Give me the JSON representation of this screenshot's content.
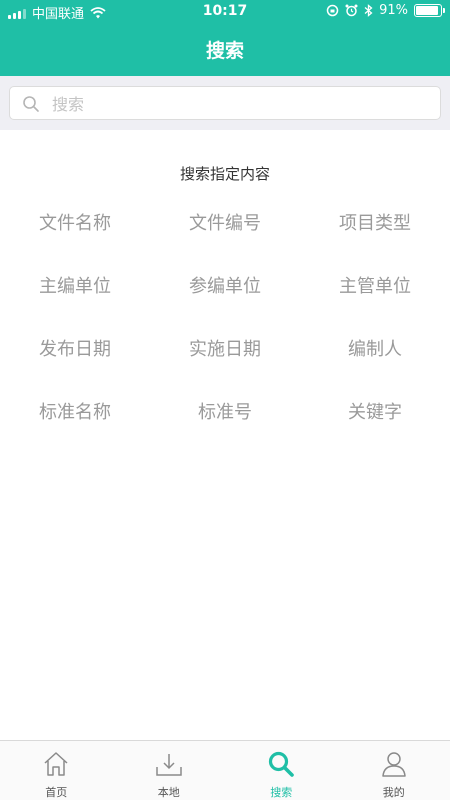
{
  "status": {
    "carrier": "中国联通",
    "time": "10:17",
    "battery": "91%",
    "battery_level": 0.91
  },
  "header": {
    "title": "搜索"
  },
  "search": {
    "placeholder": "搜索",
    "value": ""
  },
  "section_title": "搜索指定内容",
  "options": [
    "文件名称",
    "文件编号",
    "项目类型",
    "主编单位",
    "参编单位",
    "主管单位",
    "发布日期",
    "实施日期",
    "编制人",
    "标准名称",
    "标准号",
    "关键字"
  ],
  "tabs": [
    {
      "label": "首页",
      "icon": "home-icon"
    },
    {
      "label": "本地",
      "icon": "download-icon"
    },
    {
      "label": "搜索",
      "icon": "search-icon"
    },
    {
      "label": "我的",
      "icon": "user-icon"
    }
  ],
  "colors": {
    "accent": "#1fbfa6",
    "inactive": "#9a9a9a",
    "background": "#efeff4"
  }
}
